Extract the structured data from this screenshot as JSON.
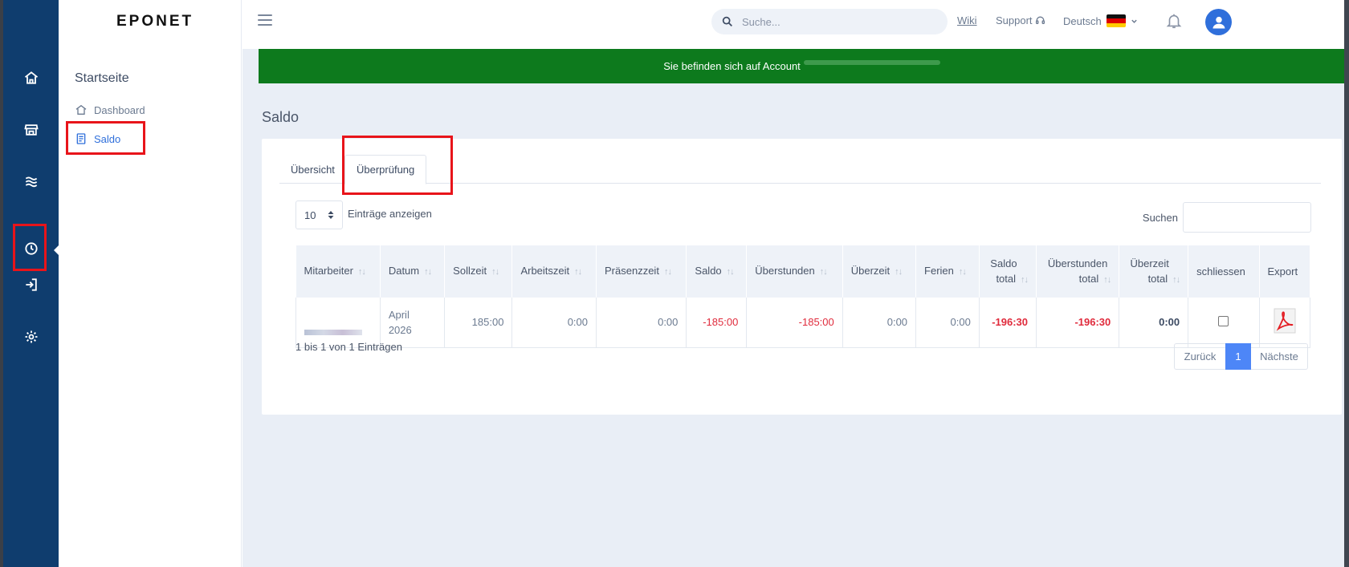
{
  "app": {
    "logo": "EPONET"
  },
  "sidebar": {
    "title": "Startseite",
    "items": [
      {
        "label": "Dashboard",
        "icon": "home-icon"
      },
      {
        "label": "Saldo",
        "icon": "document-icon",
        "active": true
      }
    ]
  },
  "rail": {
    "icons": [
      "home-icon",
      "store-icon",
      "waves-icon",
      "clock-icon",
      "login-icon",
      "gear-icon"
    ],
    "active": "clock-icon"
  },
  "topbar": {
    "search_placeholder": "Suche...",
    "wiki": "Wiki",
    "support": "Support",
    "language": "Deutsch"
  },
  "banner": {
    "text": "Sie befinden sich auf Account"
  },
  "page": {
    "title": "Saldo"
  },
  "tabs": [
    {
      "label": "Übersicht"
    },
    {
      "label": "Überprüfung",
      "active": true
    }
  ],
  "table_controls": {
    "page_length": "10",
    "length_label": "Einträge anzeigen",
    "search_label": "Suchen"
  },
  "table": {
    "columns": [
      {
        "label": "Mitarbeiter"
      },
      {
        "label": "Datum"
      },
      {
        "label": "Sollzeit"
      },
      {
        "label": "Arbeitszeit"
      },
      {
        "label": "Präsenzzeit"
      },
      {
        "label": "Saldo"
      },
      {
        "label": "Überstunden"
      },
      {
        "label": "Überzeit"
      },
      {
        "label": "Ferien"
      },
      {
        "label_line1": "Saldo",
        "label_line2": "total"
      },
      {
        "label_line1": "Überstunden",
        "label_line2": "total"
      },
      {
        "label_line1": "Überzeit",
        "label_line2": "total"
      },
      {
        "label": "schliessen"
      },
      {
        "label": "Export"
      }
    ],
    "rows": [
      {
        "datum_line1": "April",
        "datum_line2": "2026",
        "sollzeit": "185:00",
        "arbeitszeit": "0:00",
        "praesenzzeit": "0:00",
        "saldo": "-185:00",
        "ueberstunden": "-185:00",
        "ueberzeit": "0:00",
        "ferien": "0:00",
        "saldo_total": "-196:30",
        "ueberstunden_total": "-196:30",
        "ueberzeit_total": "0:00"
      }
    ]
  },
  "footer": {
    "info": "1 bis 1 von 1 Einträgen",
    "prev": "Zurück",
    "current": "1",
    "next": "Nächste"
  },
  "colors": {
    "rail": "#0f3d6e",
    "banner": "#0d7a1d",
    "accent": "#2f6fdb",
    "negative": "#e02b3c",
    "highlight": "#e8141a"
  }
}
